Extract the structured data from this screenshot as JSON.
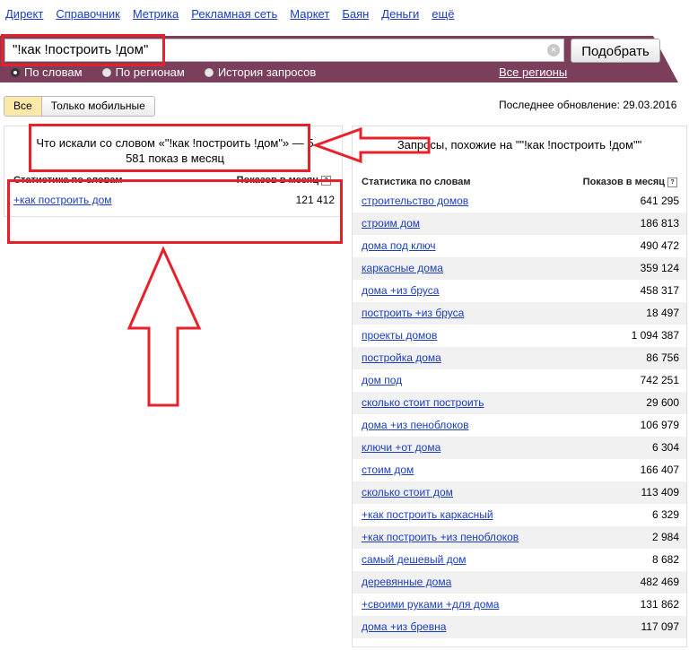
{
  "topnav": [
    "Директ",
    "Справочник",
    "Метрика",
    "Рекламная сеть",
    "Маркет",
    "Баян",
    "Деньги",
    "ещё"
  ],
  "search": {
    "value": "\"!как !построить !дом\"",
    "button": "Подобрать"
  },
  "radios": [
    {
      "label": "По словам",
      "selected": true
    },
    {
      "label": "По регионам",
      "selected": false
    },
    {
      "label": "История запросов",
      "selected": false
    }
  ],
  "regions_link": "Все регионы",
  "filter": {
    "all": "Все",
    "mobile": "Только мобильные"
  },
  "last_update": "Последнее обновление: 29.03.2016",
  "left": {
    "title": "Что искали со словом «\"!как !построить !дом\"» — 5 581 показ в месяц",
    "col_words": "Статистика по словам",
    "col_shows": "Показов в месяц",
    "rows": [
      {
        "q": "+как построить дом",
        "v": "121 412"
      }
    ]
  },
  "right": {
    "title": "Запросы, похожие на \"\"!как !построить !дом\"\"",
    "col_words": "Статистика по словам",
    "col_shows": "Показов в месяц",
    "rows": [
      {
        "q": "строительство домов",
        "v": "641 295"
      },
      {
        "q": "строим дом",
        "v": "186 813"
      },
      {
        "q": "дома под ключ",
        "v": "490 472"
      },
      {
        "q": "каркасные дома",
        "v": "359 124"
      },
      {
        "q": "дома +из бруса",
        "v": "458 317"
      },
      {
        "q": "построить +из бруса",
        "v": "18 497"
      },
      {
        "q": "проекты домов",
        "v": "1 094 387"
      },
      {
        "q": "постройка дома",
        "v": "86 756"
      },
      {
        "q": "дом под",
        "v": "742 251"
      },
      {
        "q": "сколько стоит построить",
        "v": "29 600"
      },
      {
        "q": "дома +из пеноблоков",
        "v": "106 979"
      },
      {
        "q": "ключи +от дома",
        "v": "6 304"
      },
      {
        "q": "стоим дом",
        "v": "166 407"
      },
      {
        "q": "сколько стоит дом",
        "v": "113 409"
      },
      {
        "q": "+как построить каркасный",
        "v": "6 329"
      },
      {
        "q": "+как построить +из пеноблоков",
        "v": "2 984"
      },
      {
        "q": "самый дешевый дом",
        "v": "8 682"
      },
      {
        "q": "деревянные дома",
        "v": "482 469"
      },
      {
        "q": "+своими руками +для дома",
        "v": "131 862"
      },
      {
        "q": "дома +из бревна",
        "v": "117 097"
      }
    ]
  },
  "annotation_color": "#e8202a"
}
